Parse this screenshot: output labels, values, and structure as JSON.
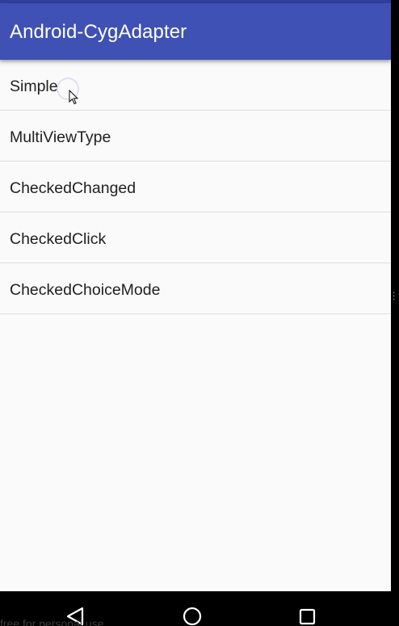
{
  "app_bar": {
    "title": "Android-CygAdapter",
    "color": "#3f51b5",
    "status_color": "#303f9f"
  },
  "list": {
    "items": [
      {
        "label": "Simple"
      },
      {
        "label": "MultiViewType"
      },
      {
        "label": "CheckedChanged"
      },
      {
        "label": "CheckedClick"
      },
      {
        "label": "CheckedChoiceMode"
      }
    ]
  },
  "nav_bar": {
    "back_icon": "back-triangle-icon",
    "home_icon": "home-circle-icon",
    "recents_icon": "recents-square-icon"
  },
  "watermark": {
    "text": "free for personal use"
  },
  "colors": {
    "background": "#fafafa",
    "divider": "#dcdcdc",
    "text": "#212121"
  }
}
